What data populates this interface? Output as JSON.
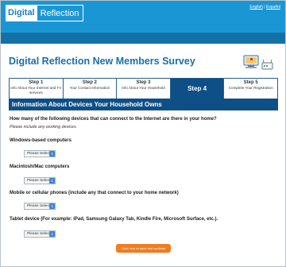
{
  "header": {
    "logo_part1": "Digital",
    "logo_part2": "Reflection",
    "lang_english": "English",
    "lang_separator": "|",
    "lang_spanish": "Español"
  },
  "survey": {
    "title": "Digital Reflection New Members Survey"
  },
  "steps": [
    {
      "number": "Step 1",
      "desc": "Info About Your Internet and TV services"
    },
    {
      "number": "Step 2",
      "desc": "Your Contact Information"
    },
    {
      "number": "Step 3",
      "desc": "Info About Your Household"
    },
    {
      "number": "Step 4",
      "desc": ""
    },
    {
      "number": "Step 5",
      "desc": "Complete Your Registration"
    }
  ],
  "active_step": 4,
  "section": {
    "title": "Information About Devices Your Household Owns"
  },
  "question": {
    "text": "How many of the following devices that can connect to the Internet are there in your home?",
    "note": "Please include any working devices."
  },
  "devices": [
    {
      "label": "Windows-based computers",
      "value": "Please Select"
    },
    {
      "label": "Macintosh/Mac computers",
      "value": "Please Select"
    },
    {
      "label": "Mobile or cellular phones (include any that connect to your home network)",
      "value": "Please Select"
    },
    {
      "label": "Tablet device (For example: iPad, Samsung Galaxy Tab, Kindle Fire, Microsoft Surface, etc.).",
      "value": "Please Select"
    }
  ],
  "continue_button": "Click here to save and continue",
  "icons": {
    "computer": "computer-icon",
    "router": "router-icon",
    "select_arrow": "chevron-updown-icon"
  },
  "colors": {
    "header_blue": "#1b96d4",
    "stripe_blue": "#1371a8",
    "title_blue": "#1b6ea8",
    "navy": "#0d4f86",
    "orange": "#ef7d22"
  }
}
